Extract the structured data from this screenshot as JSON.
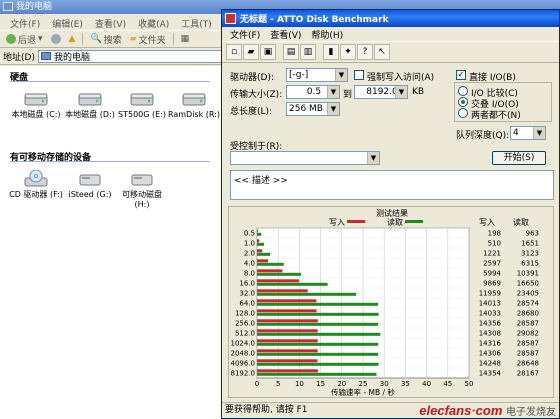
{
  "explorer": {
    "title": "我的电脑",
    "menu": [
      "文件(F)",
      "编辑(E)",
      "查看(V)",
      "收藏(A)",
      "工具(T)"
    ],
    "toolbar": {
      "back": "后退",
      "search": "搜索",
      "folders": "文件夹"
    },
    "address_label": "地址(D)",
    "address_value": "我的电脑",
    "sections": [
      {
        "title": "硬盘",
        "drives": [
          {
            "label": "本地磁盘 (C:)",
            "icon": "hard-drive-icon"
          },
          {
            "label": "本地磁盘 (D:)",
            "icon": "hard-drive-icon"
          },
          {
            "label": "ST500G (E:)",
            "icon": "hard-drive-icon"
          },
          {
            "label": "RamDisk (R:)",
            "icon": "hard-drive-icon"
          }
        ]
      },
      {
        "title": "有可移动存储的设备",
        "drives": [
          {
            "label": "CD 驱动器 (F:)",
            "icon": "cd-drive-icon"
          },
          {
            "label": "iSteed (G:)",
            "icon": "removable-drive-icon"
          },
          {
            "label": "可移动磁盘 (H:)",
            "icon": "removable-drive-icon"
          }
        ]
      }
    ]
  },
  "atto": {
    "title": "无标题 - ATTO Disk Benchmark",
    "menu": [
      "文件(F)",
      "查看(V)",
      "帮助(H)"
    ],
    "drive_label": "驱动器(D):",
    "drive_value": "[-g-]",
    "force_write_label": "强制写入访问(A)",
    "direct_io_label": "直接 I/O(B)",
    "transfer_label": "传输大小(Z):",
    "transfer_from": "0.5",
    "to_label": "到",
    "transfer_to": "8192.0",
    "kb_label": "KB",
    "length_label": "总长度(L):",
    "length_value": "256 MB",
    "io_compare_label": "I/O 比较(C)",
    "overlapped_io_label": "交叠 I/O(O)",
    "neither_label": "两者都不(N)",
    "queue_label": "队列深度(Q):",
    "queue_value": "4",
    "controlled_by_label": "受控制于(R):",
    "start_button": "开始(S)",
    "description_text": "<< 描述 >>",
    "status_text": "要获得帮助, 请按 F1"
  },
  "chart_data": {
    "type": "bar",
    "title": "测试结果",
    "legend": [
      "写入",
      "读取"
    ],
    "xlabel": "传输速率 - MB / 秒",
    "xlim": [
      0,
      50
    ],
    "xticks": [
      0,
      5,
      10,
      15,
      20,
      25,
      30,
      35,
      40,
      45,
      50
    ],
    "categories": [
      "0.5",
      "1.0",
      "2.0",
      "4.0",
      "8.0",
      "16.0",
      "32.0",
      "64.0",
      "128.0",
      "256.0",
      "512.0",
      "1024.0",
      "2048.0",
      "4096.0",
      "8192.0"
    ],
    "series": [
      {
        "name": "写入",
        "color": "#cc2a2a",
        "values": [
          198,
          510,
          1221,
          2597,
          5994,
          9869,
          11959,
          14013,
          14033,
          14356,
          14308,
          14316,
          14306,
          14248,
          14354
        ]
      },
      {
        "name": "读取",
        "color": "#1f8a1f",
        "values": [
          963,
          1651,
          3123,
          6315,
          10391,
          16650,
          23405,
          28574,
          28680,
          28587,
          29082,
          28587,
          28587,
          28648,
          28167
        ]
      }
    ],
    "column_headers": [
      "写入",
      "读取"
    ]
  }
}
